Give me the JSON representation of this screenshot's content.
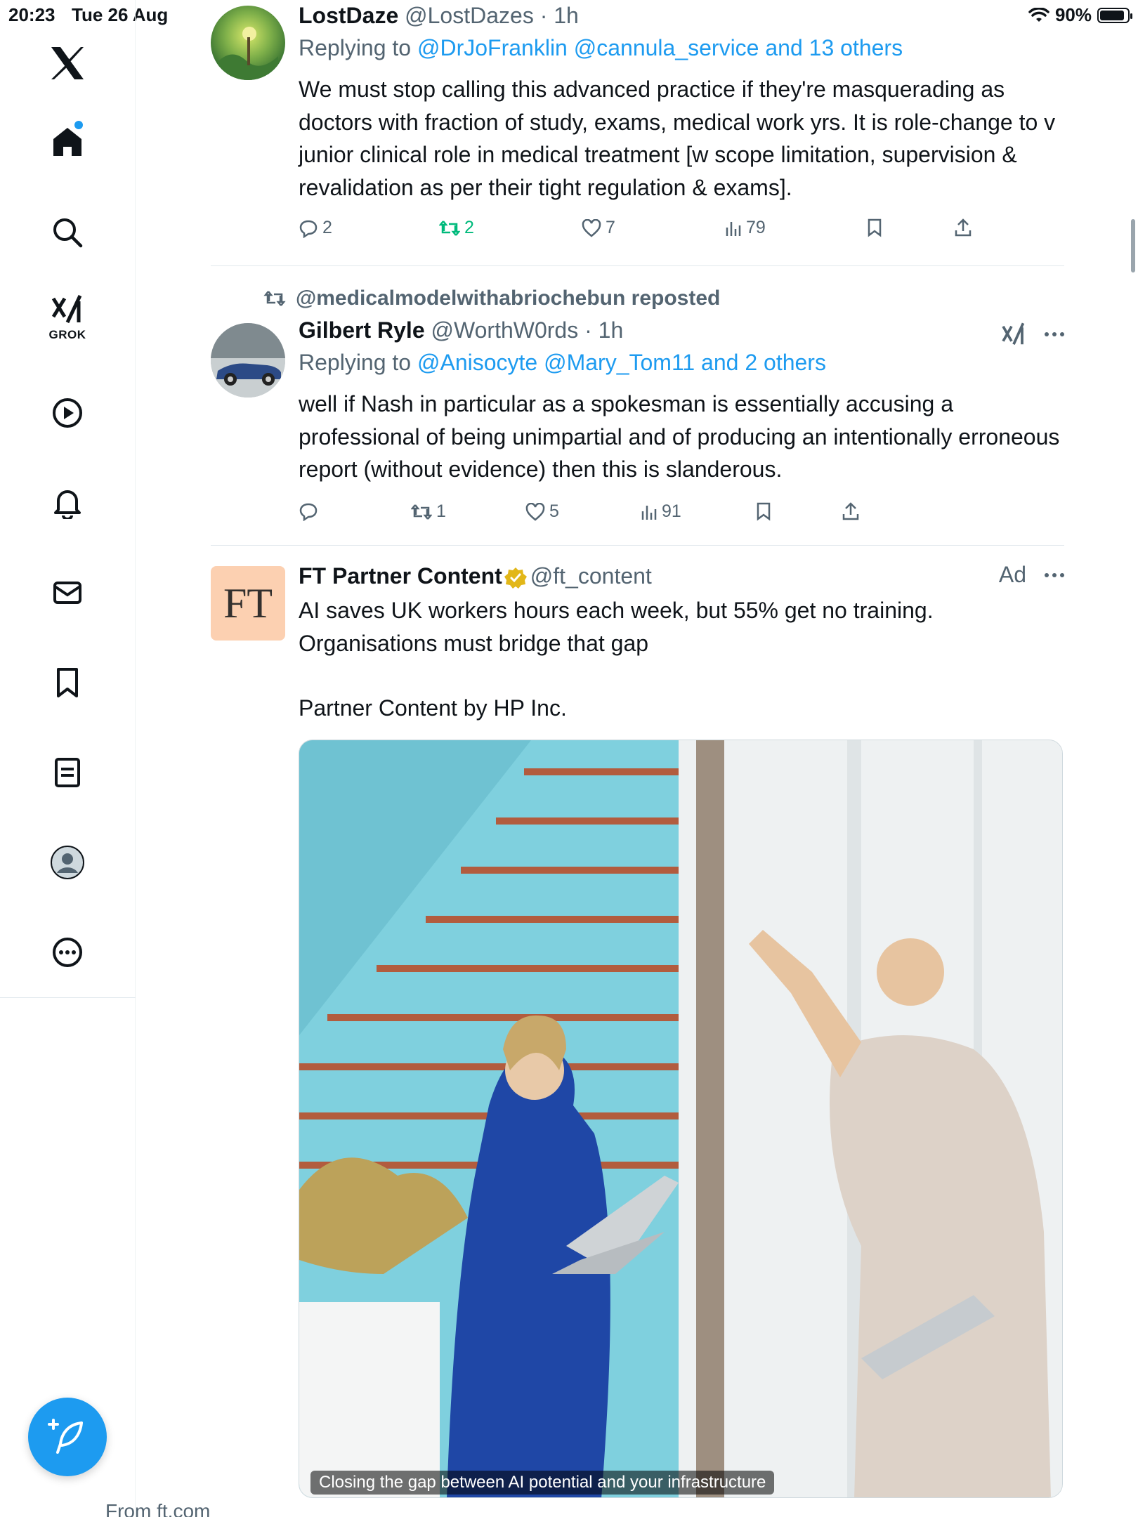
{
  "status_bar": {
    "time": "20:23",
    "date": "Tue 26 Aug",
    "battery": "90%",
    "battery_level": 0.9
  },
  "sidebar": {
    "grok_label": "GROK",
    "icons": [
      "x-logo-icon",
      "home-icon",
      "search-icon",
      "grok-icon",
      "video-icon",
      "notifications-icon",
      "messages-icon",
      "bookmarks-icon",
      "lists-icon",
      "profile-icon",
      "more-icon"
    ]
  },
  "tweets": [
    {
      "name": "LostDaze",
      "handle": "@LostDazes",
      "sep": " · ",
      "time": "1h",
      "reply_prefix": "Replying to ",
      "mentions": "@DrJoFranklin @cannula_service and 13 others",
      "text": "We must stop calling this advanced practice if they're masquerading as doctors with fraction of study, exams, medical work yrs. It is role-change to v junior clinical role in medical treatment [w scope limitation, supervision & revalidation as per their tight regulation & exams].",
      "replies": "2",
      "reposts": "2",
      "likes": "7",
      "views": "79"
    },
    {
      "reposted_by": "@medicalmodelwithabriochebun reposted",
      "name": "Gilbert Ryle",
      "handle": "@WorthW0rds",
      "sep": " · ",
      "time": "1h",
      "reply_prefix": "Replying to ",
      "mentions": "@Anisocyte @Mary_Tom11 and 2 others",
      "text": "well if Nash in particular as a spokesman is essentially accusing a professional of being unimpartial and of producing an intentionally erroneous report (without evidence) then this is slanderous.",
      "replies": "",
      "reposts": "1",
      "likes": "5",
      "views": "91"
    }
  ],
  "ad": {
    "logo_text": "FT",
    "name": "FT Partner Content",
    "handle": "@ft_content",
    "ad_label": "Ad",
    "text_line1": "AI saves UK workers hours each week, but 55% get no training.",
    "text_line2": "Organisations must bridge that gap",
    "text_line3": "Partner Content by HP Inc.",
    "media_caption": "Closing the gap between AI potential and your infrastructure",
    "from": "From ft.com"
  },
  "colors": {
    "accent": "#1d9bf0",
    "repost_green": "#00ba7c",
    "muted": "#536471",
    "verified_gold": "#e2b719"
  }
}
